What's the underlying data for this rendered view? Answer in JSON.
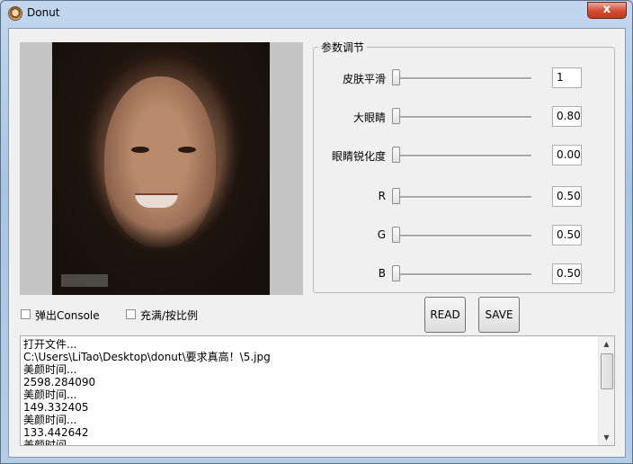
{
  "window": {
    "title": "Donut",
    "close_label": "x"
  },
  "params": {
    "legend": "参数调节",
    "rows": [
      {
        "label": "皮肤平滑",
        "value": "1"
      },
      {
        "label": "大眼睛",
        "value": "0.80"
      },
      {
        "label": "眼睛锐化度",
        "value": "0.00"
      },
      {
        "label": "R",
        "value": "0.50"
      },
      {
        "label": "G",
        "value": "0.50"
      },
      {
        "label": "B",
        "value": "0.50"
      }
    ]
  },
  "options": {
    "console_label": "弹出Console",
    "fill_label": "充满/按比例"
  },
  "buttons": {
    "read": "READ",
    "save": "SAVE"
  },
  "console": {
    "lines": [
      "打开文件...",
      "C:\\Users\\LiTao\\Desktop\\donut\\要求真高！\\5.jpg",
      "美颜时间...",
      "2598.284090",
      "美颜时间...",
      "149.332405",
      "美颜时间...",
      "133.442642",
      "美颜时间..."
    ]
  }
}
